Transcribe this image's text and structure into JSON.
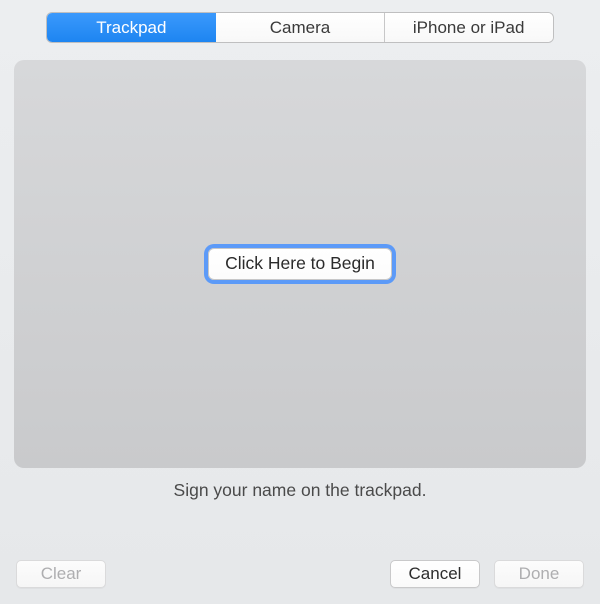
{
  "tabs": {
    "items": [
      {
        "label": "Trackpad",
        "selected": true
      },
      {
        "label": "Camera",
        "selected": false
      },
      {
        "label": "iPhone or iPad",
        "selected": false
      }
    ]
  },
  "canvas": {
    "begin_label": "Click Here to Begin"
  },
  "instruction": "Sign your name on the trackpad.",
  "buttons": {
    "clear": {
      "label": "Clear",
      "enabled": false
    },
    "cancel": {
      "label": "Cancel",
      "enabled": true
    },
    "done": {
      "label": "Done",
      "enabled": false
    }
  }
}
